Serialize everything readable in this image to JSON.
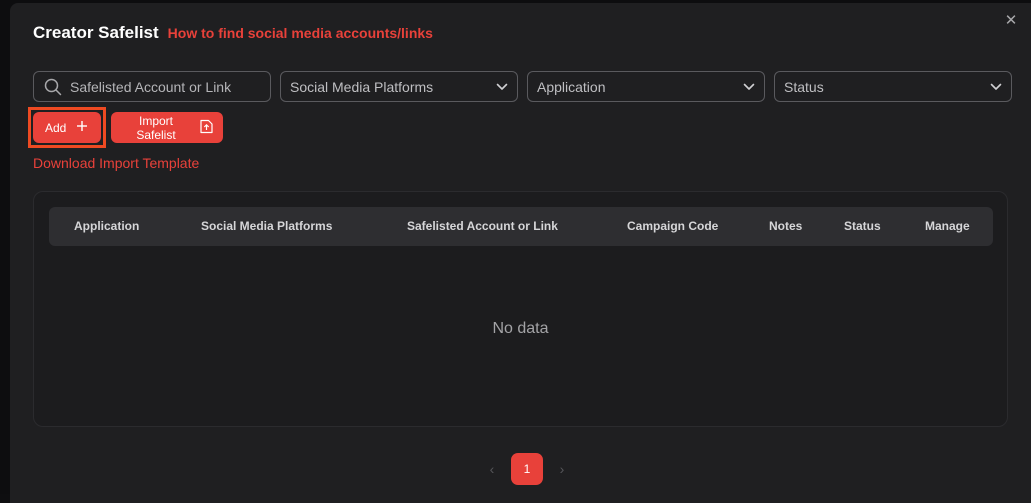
{
  "modal": {
    "title": "Creator Safelist",
    "help_link": "How to find social media accounts/links",
    "close_icon": "close-icon"
  },
  "filters": {
    "search_placeholder": "Safelisted Account or Link",
    "platform_label": "Social Media Platforms",
    "application_label": "Application",
    "status_label": "Status"
  },
  "actions": {
    "add_label": "Add",
    "import_label": "Import Safelist",
    "download_label": "Download Import Template"
  },
  "table": {
    "columns": [
      "Application",
      "Social Media Platforms",
      "Safelisted Account or Link",
      "Campaign Code",
      "Notes",
      "Status",
      "Manage"
    ],
    "empty_text": "No data"
  },
  "pagination": {
    "current_page": "1",
    "prev_symbol": "‹",
    "next_symbol": "›"
  },
  "colors": {
    "accent": "#e8413a",
    "highlight": "#ee4a22",
    "background": "#1f1f21"
  }
}
